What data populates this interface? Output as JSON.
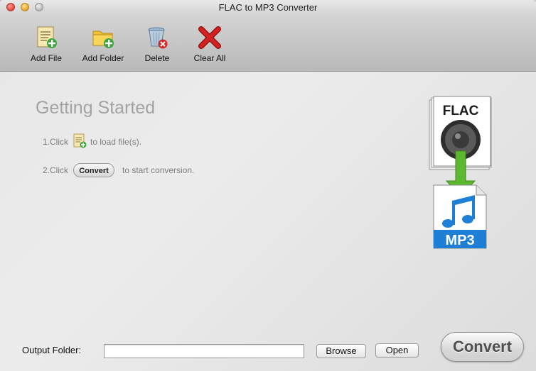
{
  "window": {
    "title": "FLAC to MP3 Converter"
  },
  "toolbar": {
    "add_file": {
      "label": "Add File",
      "icon": "add-file-icon"
    },
    "add_folder": {
      "label": "Add Folder",
      "icon": "add-folder-icon"
    },
    "delete": {
      "label": "Delete",
      "icon": "trash-icon"
    },
    "clear_all": {
      "label": "Clear All",
      "icon": "red-x-icon"
    }
  },
  "main": {
    "heading": "Getting Started",
    "step1": {
      "prefix": "1.Click",
      "suffix": "to load file(s)."
    },
    "step2": {
      "prefix": "2.Click",
      "button": "Convert",
      "suffix": "to start conversion."
    },
    "hero": {
      "from_format": "FLAC",
      "to_format": "MP3"
    }
  },
  "bottom": {
    "output_label": "Output Folder:",
    "output_value": "",
    "browse_label": "Browse",
    "open_label": "Open",
    "convert_label": "Convert"
  },
  "colors": {
    "heading": "#a3a3a3",
    "arrow_green": "#5cb82e",
    "mp3_blue": "#1e7fd6",
    "delete_red": "#c0181a"
  }
}
